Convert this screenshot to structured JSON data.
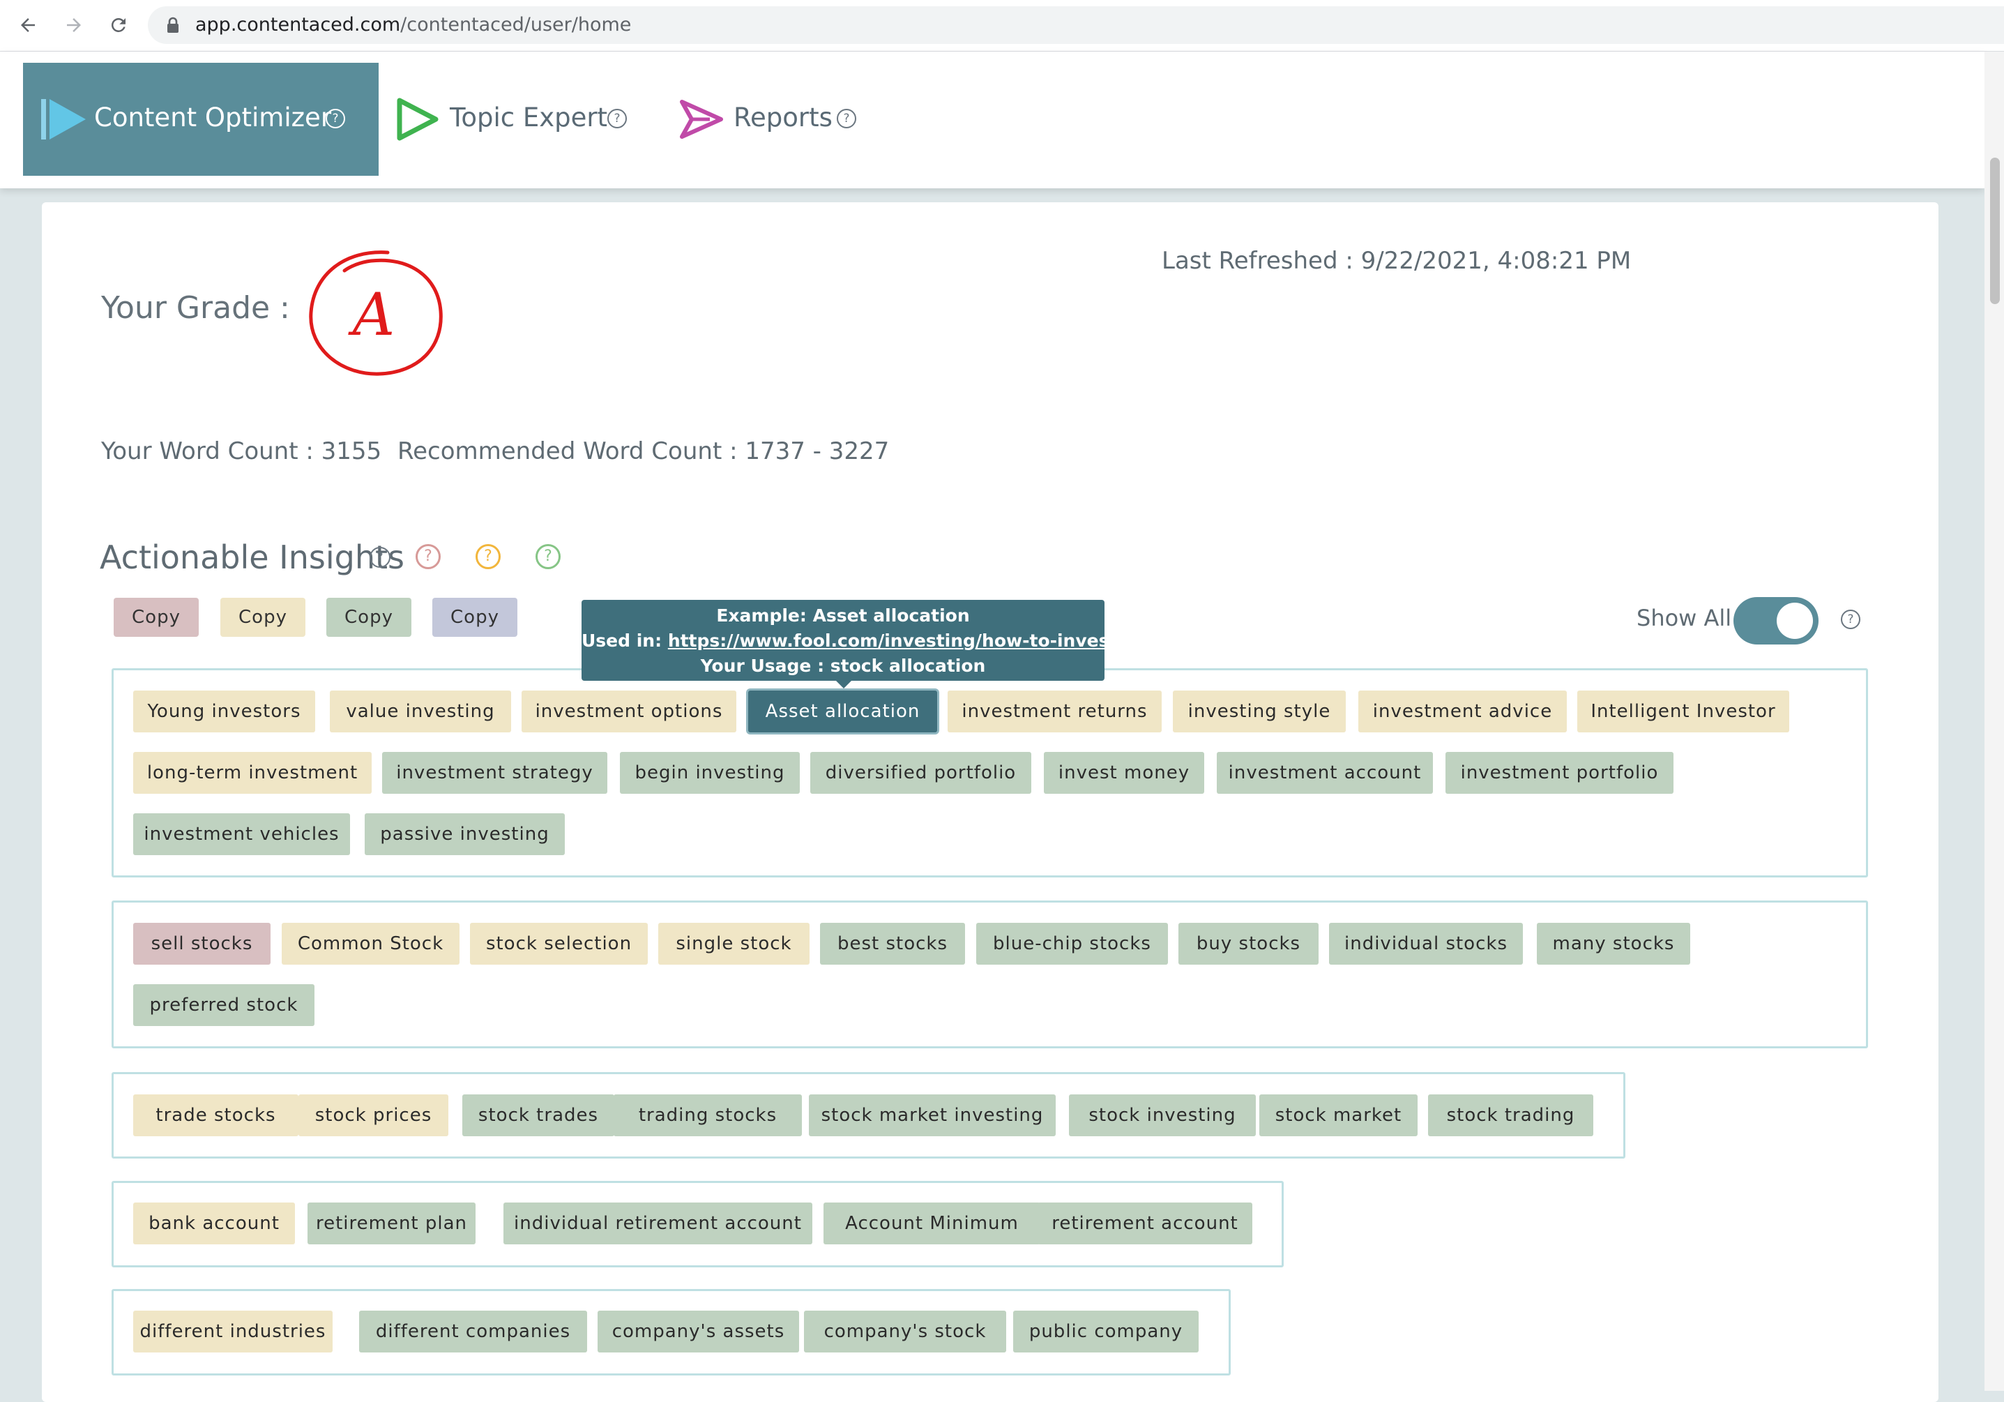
{
  "browser": {
    "url_host": "app.contentaced.com",
    "url_path": "/contentaced/user/home"
  },
  "nav": {
    "items": [
      {
        "label": "Content Optimizer",
        "active": true,
        "icon": "play-logo-icon"
      },
      {
        "label": "Topic Expert",
        "active": false,
        "icon": "play-logo-icon"
      },
      {
        "label": "Reports",
        "active": false,
        "icon": "send-logo-icon"
      }
    ],
    "help_glyph": "?"
  },
  "grade": {
    "label": "Your Grade :",
    "value": "A"
  },
  "last_refreshed": "Last Refreshed : 9/22/2021, 4:08:21 PM",
  "word_count": {
    "yours": "Your Word Count : 3155",
    "recommended": "Recommended Word Count : 1737 - 3227"
  },
  "insights": {
    "title": "Actionable Insights",
    "copy_label": "Copy",
    "show_all_label": "Show All",
    "show_all_on": true
  },
  "colors": {
    "accent": "#5a8d9a",
    "tooltip": "#3f6f7c",
    "tan": "#f0e6c6",
    "green": "#bfd2c0",
    "pink": "#d8bfc1",
    "blue": "#c3c7da",
    "help_pink": "#d79a98",
    "help_yellow": "#f2b63c",
    "help_green": "#86c586"
  },
  "tooltip": {
    "example": "Example: Asset allocation",
    "used_in_prefix": "Used in: ",
    "used_in_link": "https://www.fool.com/investing/how-to-invest/stocks/",
    "usage": "Your Usage : stock allocation"
  },
  "groups": [
    {
      "keywords": [
        {
          "text": "Young investors",
          "color": "tan"
        },
        {
          "text": "value investing",
          "color": "tan"
        },
        {
          "text": "investment options",
          "color": "tan"
        },
        {
          "text": "Asset allocation",
          "color": "tan",
          "selected": true
        },
        {
          "text": "investment returns",
          "color": "tan"
        },
        {
          "text": "investing style",
          "color": "tan"
        },
        {
          "text": "investment advice",
          "color": "tan"
        },
        {
          "text": "Intelligent Investor",
          "color": "tan"
        },
        {
          "text": "long-term investment",
          "color": "tan"
        },
        {
          "text": "investment strategy",
          "color": "green"
        },
        {
          "text": "begin investing",
          "color": "green"
        },
        {
          "text": "diversified portfolio",
          "color": "green"
        },
        {
          "text": "invest money",
          "color": "green"
        },
        {
          "text": "investment account",
          "color": "green"
        },
        {
          "text": "investment portfolio",
          "color": "green"
        },
        {
          "text": "investment vehicles",
          "color": "green"
        },
        {
          "text": "passive investing",
          "color": "green"
        }
      ]
    },
    {
      "keywords": [
        {
          "text": "sell stocks",
          "color": "pink"
        },
        {
          "text": "Common Stock",
          "color": "tan"
        },
        {
          "text": "stock selection",
          "color": "tan"
        },
        {
          "text": "single stock",
          "color": "tan"
        },
        {
          "text": "best stocks",
          "color": "green"
        },
        {
          "text": "blue-chip stocks",
          "color": "green"
        },
        {
          "text": "buy stocks",
          "color": "green"
        },
        {
          "text": "individual stocks",
          "color": "green"
        },
        {
          "text": "many stocks",
          "color": "green"
        },
        {
          "text": "preferred stock",
          "color": "green"
        }
      ]
    },
    {
      "keywords": [
        {
          "text": "trade stocks",
          "color": "tan"
        },
        {
          "text": "stock prices",
          "color": "tan"
        },
        {
          "text": "stock trades",
          "color": "green"
        },
        {
          "text": "trading stocks",
          "color": "green"
        },
        {
          "text": "stock market investing",
          "color": "green"
        },
        {
          "text": "stock investing",
          "color": "green"
        },
        {
          "text": "stock market",
          "color": "green"
        },
        {
          "text": "stock trading",
          "color": "green"
        }
      ]
    },
    {
      "keywords": [
        {
          "text": "bank account",
          "color": "tan"
        },
        {
          "text": "retirement plan",
          "color": "green"
        },
        {
          "text": "individual retirement account",
          "color": "green"
        },
        {
          "text": "Account Minimum",
          "color": "green"
        },
        {
          "text": "retirement account",
          "color": "green"
        }
      ]
    },
    {
      "keywords": [
        {
          "text": "different industries",
          "color": "tan"
        },
        {
          "text": "different companies",
          "color": "green"
        },
        {
          "text": "company's assets",
          "color": "green"
        },
        {
          "text": "company's stock",
          "color": "green"
        },
        {
          "text": "public company",
          "color": "green"
        }
      ]
    }
  ]
}
